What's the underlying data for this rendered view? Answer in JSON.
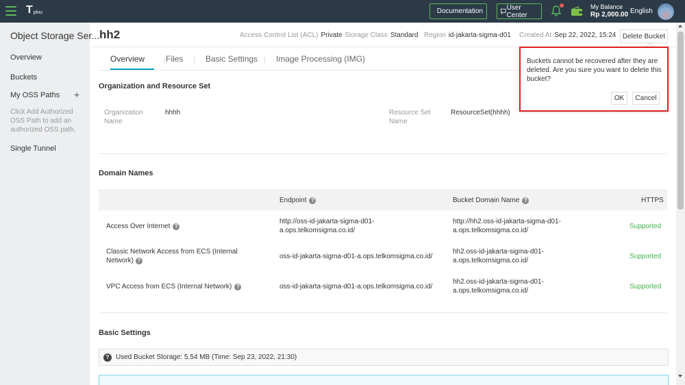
{
  "topbar": {
    "logo_mark": "T",
    "logo_sub": "plou",
    "documentation": "Documentation",
    "user_center": "User Center",
    "balance_label": "My Balance",
    "balance_value": "Rp 2,000.00",
    "language": "English"
  },
  "sidebar": {
    "title": "Object Storage Ser...",
    "items": [
      "Overview",
      "Buckets",
      "My OSS Paths",
      "Single Tunnel"
    ],
    "hint": "Click Add Authorized OSS Path to add an authorized OSS path.",
    "plus": "+"
  },
  "header": {
    "bucket_name": "hh2",
    "acl_label": "Access Control List (ACL)",
    "acl_value": "Private",
    "storage_label": "Storage Class",
    "storage_value": "Standard",
    "region_label": "Region",
    "region_value": "id-jakarta-sigma-d01",
    "created_label": "Created At",
    "created_value": "Sep 22, 2022, 15:24",
    "delete_button": "Delete Bucket"
  },
  "tabs": [
    "Overview",
    "Files",
    "Basic Settings",
    "Image Processing (IMG)"
  ],
  "org": {
    "title": "Organization and Resource Set",
    "org_label_1": "Organization",
    "org_label_2": "Name",
    "org_value": "hhhh",
    "rs_label_1": "Resource Set",
    "rs_label_2": "Name",
    "rs_value": "ResourceSet(hhhh)"
  },
  "domains": {
    "title": "Domain Names",
    "headers": [
      "Endpoint",
      "Bucket Domain Name",
      "HTTPS"
    ],
    "rows": [
      {
        "name": "Access Over Internet",
        "endpoint_1": "http://oss-id-jakarta-sigma-d01-",
        "endpoint_2": "a.ops.telkomsigma.co.id/",
        "domain_1": "http://hh2.oss-id-jakarta-sigma-d01-",
        "domain_2": "a.ops.telkomsigma.co.id/",
        "https": "Supported"
      },
      {
        "name": "Classic Network Access from ECS (Internal Network)",
        "endpoint_1": "oss-id-jakarta-sigma-d01-a.ops.telkomsigma.co.id/",
        "endpoint_2": "",
        "domain_1": "hh2.oss-id-jakarta-sigma-d01-",
        "domain_2": "a.ops.telkomsigma.co.id/",
        "https": "Supported"
      },
      {
        "name": "VPC Access from ECS (Internal Network)",
        "endpoint_1": "oss-id-jakarta-sigma-d01-a.ops.telkomsigma.co.id/",
        "endpoint_2": "",
        "domain_1": "hh2.oss-id-jakarta-sigma-d01-",
        "domain_2": "a.ops.telkomsigma.co.id/",
        "https": "Supported"
      }
    ]
  },
  "basic": {
    "title": "Basic Settings",
    "storage_text": "Used Bucket Storage: 5.54 MB (Time: Sep 23, 2022, 21:30)"
  },
  "popover": {
    "text": "Buckets cannot be recovered after they are deleted. Are you sure you want to delete this bucket?",
    "ok": "OK",
    "cancel": "Cancel"
  },
  "colors": {
    "topbar": "#2b3a46",
    "accent": "#00a2ca",
    "supported": "#3fb54a",
    "highlight_border": "#e02020"
  },
  "icons": [
    "menu-icon",
    "bell-icon",
    "wallet-icon",
    "help-icon",
    "document-icon",
    "chat-icon"
  ]
}
